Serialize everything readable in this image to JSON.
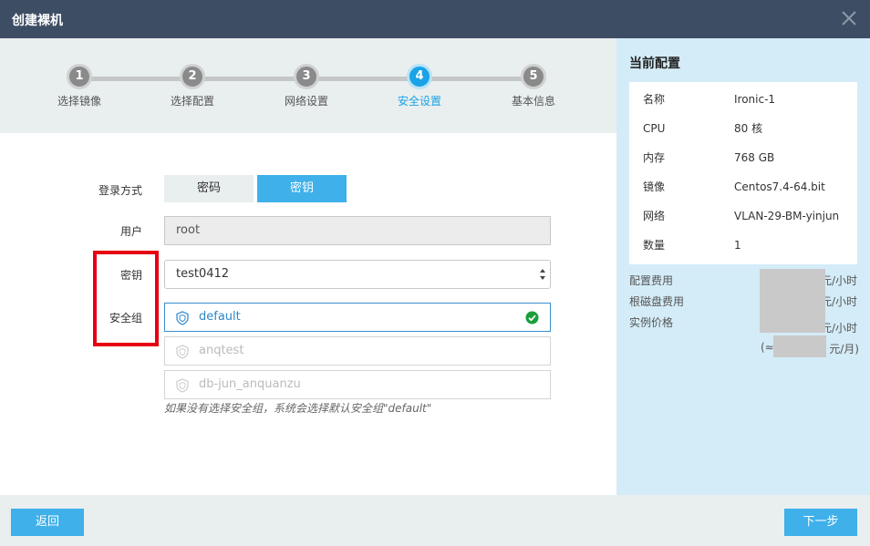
{
  "window": {
    "title": "创建裸机",
    "close_icon": "close-icon"
  },
  "steps": [
    {
      "number": "1",
      "label": "选择镜像",
      "active": false
    },
    {
      "number": "2",
      "label": "选择配置",
      "active": false
    },
    {
      "number": "3",
      "label": "网络设置",
      "active": false
    },
    {
      "number": "4",
      "label": "安全设置",
      "active": true
    },
    {
      "number": "5",
      "label": "基本信息",
      "active": false
    }
  ],
  "form": {
    "login_method": {
      "label": "登录方式",
      "options": [
        "密码",
        "密钥"
      ],
      "selected": "密钥"
    },
    "user": {
      "label": "用户",
      "value": "root"
    },
    "key": {
      "label": "密钥",
      "value": "test0412"
    },
    "security_group": {
      "label": "安全组",
      "items": [
        {
          "name": "default",
          "selected": true
        },
        {
          "name": "anqtest",
          "selected": false
        },
        {
          "name": "db-jun_anquanzu",
          "selected": false
        }
      ],
      "hint": "如果没有选择安全组，系统会选择默认安全组\"default\""
    }
  },
  "side": {
    "title": "当前配置",
    "config": [
      {
        "key": "名称",
        "value": "Ironic-1"
      },
      {
        "key": "CPU",
        "value": "80 核"
      },
      {
        "key": "内存",
        "value": "768 GB"
      },
      {
        "key": "镜像",
        "value": "Centos7.4-64.bit"
      },
      {
        "key": "网络",
        "value": "VLAN-29-BM-yinjun"
      },
      {
        "key": "数量",
        "value": "1"
      }
    ],
    "pricing": {
      "config_fee": "配置费用",
      "disk_fee": "根磁盘费用",
      "instance_price": "实例价格",
      "unit_hour": "元/小时",
      "approx_prefix": "(≈",
      "unit_month": "元/月)"
    }
  },
  "footer": {
    "back": "返回",
    "next": "下一步"
  },
  "colors": {
    "accent": "#1aa3e6",
    "titlebar": "#3d4d63",
    "highlight": "#e60012"
  }
}
